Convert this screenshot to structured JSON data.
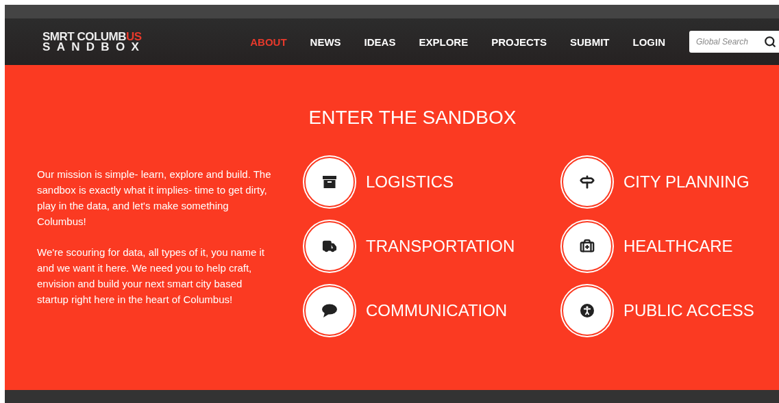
{
  "logo": {
    "line1": "SMRT COLUMB",
    "line1_accent": "US",
    "line2": "SANDBOX"
  },
  "nav": [
    {
      "label": "ABOUT",
      "selected": true
    },
    {
      "label": "NEWS",
      "selected": false
    },
    {
      "label": "IDEAS",
      "selected": false
    },
    {
      "label": "EXPLORE",
      "selected": false
    },
    {
      "label": "PROJECTS",
      "selected": false
    },
    {
      "label": "SUBMIT",
      "selected": false
    },
    {
      "label": "LOGIN",
      "selected": false
    }
  ],
  "search": {
    "placeholder": "Global Search"
  },
  "hero": {
    "title": "ENTER THE SANDBOX",
    "paragraphs": [
      "Our mission is simple- learn, explore and build.  The sandbox is exactly what it implies- time to get dirty, play in the data, and let's make something Columbus!",
      "We're scouring for data, all types of it, you name it and we want it here.  We need you to help craft, envision and build your next smart city based startup right here in the heart of Columbus!"
    ],
    "categories": [
      {
        "label": "LOGISTICS",
        "kind": "box"
      },
      {
        "label": "CITY PLANNING",
        "kind": "signpost"
      },
      {
        "label": "TRANSPORTATION",
        "kind": "truck"
      },
      {
        "label": "HEALTHCARE",
        "kind": "medkit"
      },
      {
        "label": "COMMUNICATION",
        "kind": "speech"
      },
      {
        "label": "PUBLIC ACCESS",
        "kind": "accessibility"
      }
    ]
  }
}
